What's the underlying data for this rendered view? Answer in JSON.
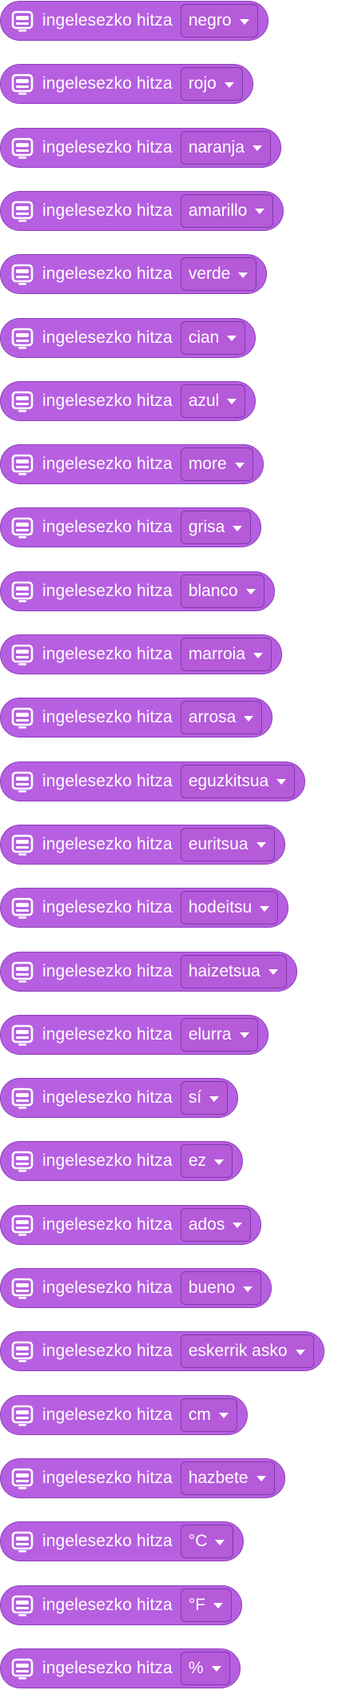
{
  "block": {
    "label": "ingelesezko hitza",
    "icon": "robot-face-icon",
    "colors": {
      "fill": "#b75fe1",
      "border": "#8d3fbd",
      "dropdown_border": "#7e3aa8",
      "text": "#ffffff"
    }
  },
  "words": [
    "negro",
    "rojo",
    "naranja",
    "amarillo",
    "verde",
    "cian",
    "azul",
    "more",
    "grisa",
    "blanco",
    "marroia",
    "arrosa",
    "eguzkitsua",
    "euritsua",
    "hodeitsu",
    "haizetsua",
    "elurra",
    "sí",
    "ez",
    "ados",
    "bueno",
    "eskerrik asko",
    "cm",
    "hazbete",
    "°C",
    "°F",
    "%"
  ]
}
